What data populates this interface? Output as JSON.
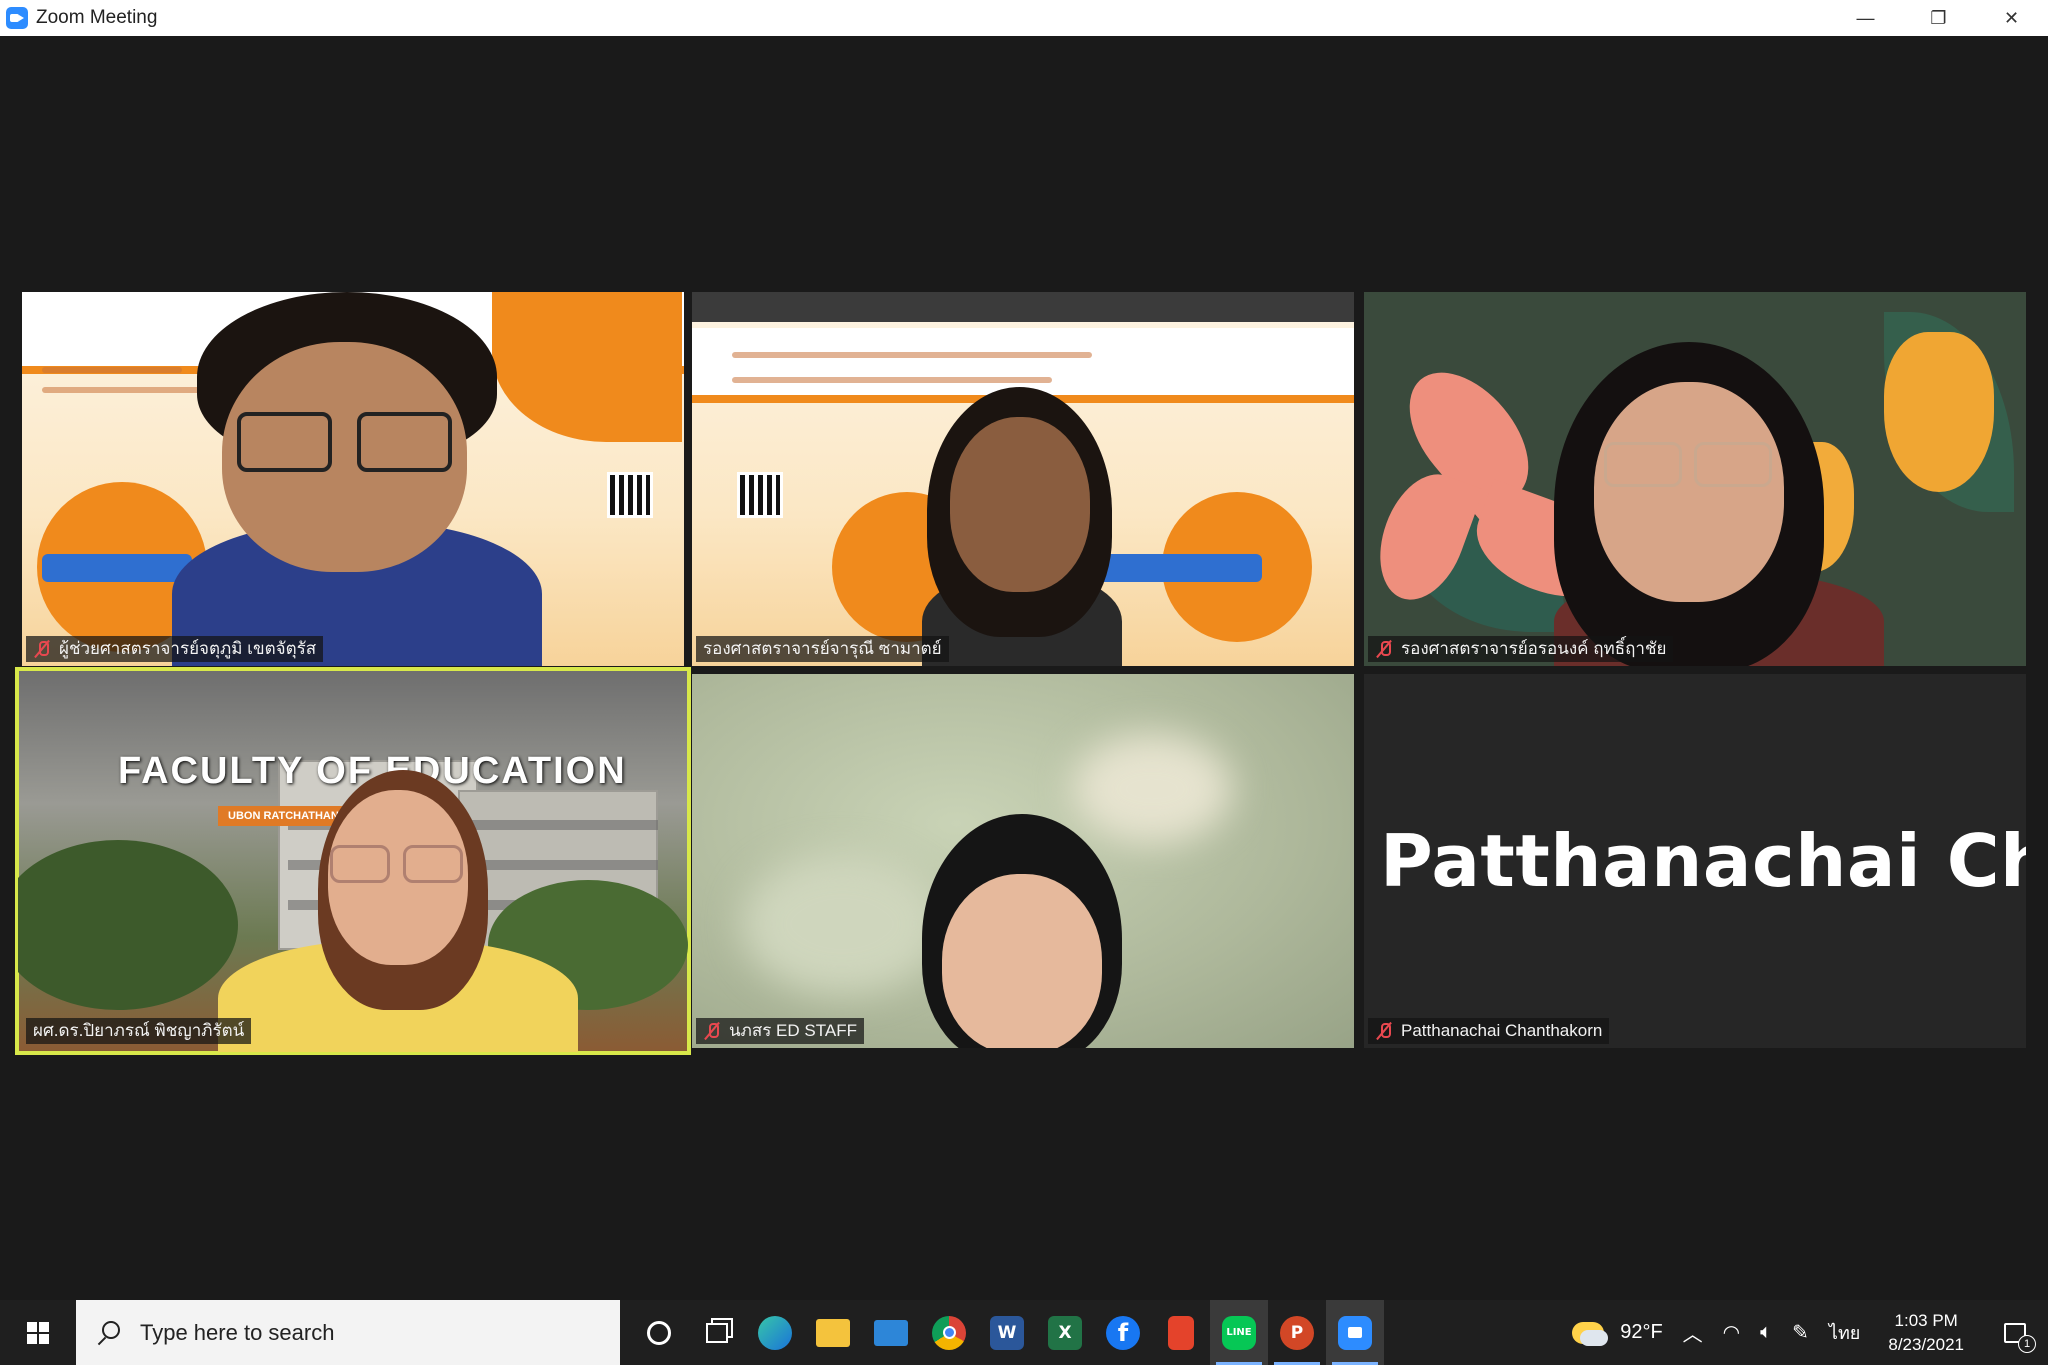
{
  "window": {
    "title": "Zoom Meeting",
    "controls": {
      "minimize": "—",
      "restore": "❐",
      "close": "✕"
    }
  },
  "participants": [
    {
      "name": "ผู้ช่วยศาสตราจารย์จตุภูมิ เขตจัตุรัส",
      "muted": true,
      "active": false
    },
    {
      "name": "รองศาสตราจารย์จารุณี ซามาตย์",
      "muted": false,
      "active": false
    },
    {
      "name": "รองศาสตราจารย์อรอนงค์ ฤทธิ์ฤาชัย",
      "muted": true,
      "active": false
    },
    {
      "name": "ผศ.ดร.ปิยาภรณ์ พิชญาภิรัตน์",
      "muted": false,
      "active": true
    },
    {
      "name": "นภสร ED STAFF",
      "muted": true,
      "active": false
    },
    {
      "name": "Patthanachai Chanthakorn",
      "muted": true,
      "active": false,
      "display_name": "Patthanachai  Ch..."
    }
  ],
  "tile_art": {
    "faculty_title": "FACULTY OF EDUCATION",
    "faculty_subtitle": "UBON RATCHATHANI UNIVERSITY"
  },
  "taskbar": {
    "search_placeholder": "Type here to search",
    "apps": [
      "cortana-icon",
      "task-view-icon",
      "edge-icon",
      "file-explorer-icon",
      "mail-icon",
      "chrome-icon",
      "word-icon",
      "excel-icon",
      "facebook-icon",
      "office-icon",
      "line-icon",
      "powerpoint-icon",
      "zoom-icon"
    ],
    "app_letters": {
      "word": "W",
      "excel": "X",
      "facebook": "f",
      "powerpoint": "P",
      "line": "LINE"
    },
    "weather": "92°F",
    "language": "ไทย",
    "time": "1:03 PM",
    "date": "8/23/2021",
    "notifications": "1"
  },
  "colors": {
    "active_speaker": "#d8e84a",
    "muted_icon": "#e8484f",
    "zoom_blue": "#2d8cff"
  }
}
